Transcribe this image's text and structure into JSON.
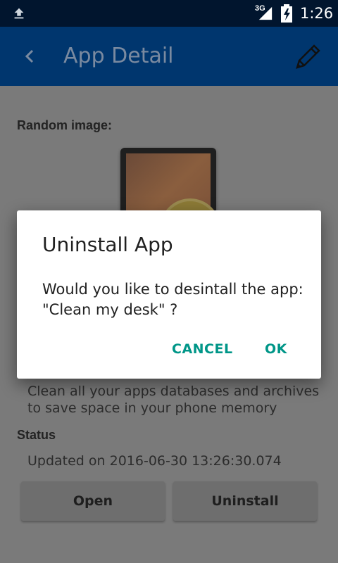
{
  "status_bar": {
    "network": "3G",
    "time": "1:26"
  },
  "app_bar": {
    "title": "App Detail"
  },
  "content": {
    "random_image_label": "Random image:",
    "description": "Clean all your apps databases and archives to save space in your phone  memory",
    "status_label": "Status",
    "updated_text": "Updated on 2016-06-30 13:26:30.074",
    "open_button": "Open",
    "uninstall_button": "Uninstall"
  },
  "dialog": {
    "title": "Uninstall App",
    "message": "Would you like to desintall the app: \"Clean my desk\" ?",
    "cancel": "CANCEL",
    "ok": "OK",
    "accent_color": "#009688"
  },
  "colors": {
    "app_bar": "#00366e",
    "status_bar": "#01152e"
  }
}
